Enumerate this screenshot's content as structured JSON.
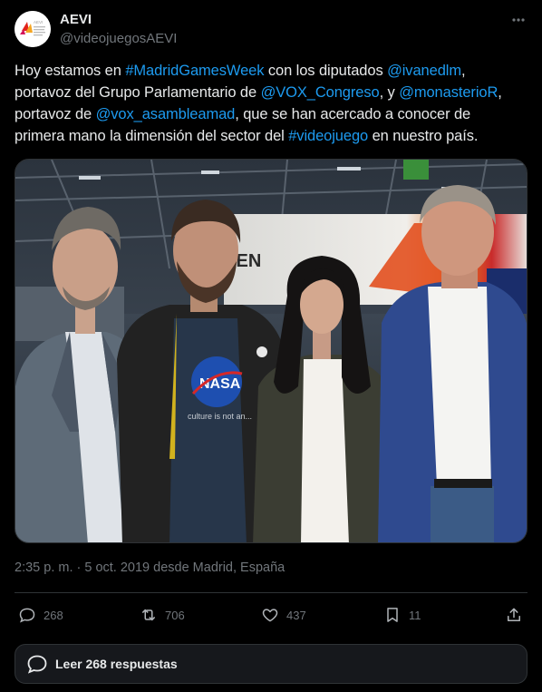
{
  "account": {
    "name": "AEVI",
    "handle": "@videojuegosAEVI",
    "avatar_text": "ASOCIACIÓN ESPAÑOLA DE VIDEOJUEGOS"
  },
  "tweet": {
    "lines": [
      [
        {
          "t": "Hoy estamos en ",
          "link": false
        },
        {
          "t": "#MadridGamesWeek",
          "link": true
        },
        {
          "t": " con los diputados ",
          "link": false
        },
        {
          "t": "@ivanedlm",
          "link": true
        },
        {
          "t": ",",
          "link": false
        }
      ],
      [
        {
          "t": "portavoz del Grupo Parlamentario de ",
          "link": false
        },
        {
          "t": "@VOX_Congreso",
          "link": true
        },
        {
          "t": ", y ",
          "link": false
        },
        {
          "t": "@monasterioR",
          "link": true
        },
        {
          "t": ",",
          "link": false
        }
      ],
      [
        {
          "t": "portavoz de ",
          "link": false
        },
        {
          "t": "@vox_asambleamad",
          "link": true
        },
        {
          "t": ", que se han acercado a conocer de",
          "link": false
        }
      ],
      [
        {
          "t": "primera mano la dimensión del sector del ",
          "link": false
        },
        {
          "t": "#videojuego",
          "link": true
        },
        {
          "t": " en nuestro país.",
          "link": false
        }
      ]
    ],
    "photo": {
      "shirt_text": "NASA",
      "shirt_subtext": "culture is not an...",
      "banner_text": "IEN"
    },
    "timestamp": "2:35 p. m. · 5 oct. 2019 desde Madrid, España"
  },
  "actions": {
    "replies": "268",
    "retweets": "706",
    "likes": "437",
    "bookmarks": "11"
  },
  "read_replies_label": "Leer 268 respuestas",
  "colors": {
    "background": "#000000",
    "text": "#e7e9ea",
    "secondary": "#71767b",
    "link": "#1d9bf0",
    "border": "#2f3336"
  }
}
